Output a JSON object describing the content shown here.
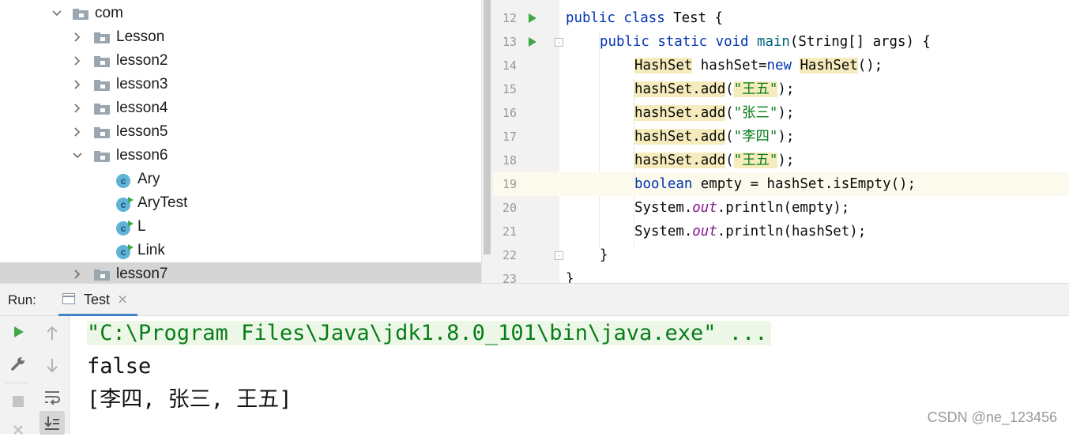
{
  "project_tree": {
    "items": [
      {
        "label": "com",
        "type": "package",
        "expanded": true
      },
      {
        "label": "Lesson",
        "type": "package",
        "expanded": false
      },
      {
        "label": "lesson2",
        "type": "package",
        "expanded": false
      },
      {
        "label": "lesson3",
        "type": "package",
        "expanded": false
      },
      {
        "label": "lesson4",
        "type": "package",
        "expanded": false
      },
      {
        "label": "lesson5",
        "type": "package",
        "expanded": false
      },
      {
        "label": "lesson6",
        "type": "package",
        "expanded": true
      },
      {
        "label": "Ary",
        "type": "class"
      },
      {
        "label": "AryTest",
        "type": "runnable-class"
      },
      {
        "label": "L",
        "type": "runnable-class"
      },
      {
        "label": "Link",
        "type": "runnable-class"
      },
      {
        "label": "lesson7",
        "type": "package",
        "expanded": false,
        "selected": true
      }
    ],
    "class_icon_letter": "c"
  },
  "editor": {
    "line_numbers": [
      "12",
      "13",
      "14",
      "15",
      "16",
      "17",
      "18",
      "19",
      "20",
      "21",
      "22",
      "23"
    ],
    "lines": {
      "l12": {
        "kw1": "public",
        "kw2": "class",
        "rest": " Test {"
      },
      "l13": {
        "kw1": "public",
        "kw2": "static",
        "kw3": "void",
        "fn": "main",
        "rest": "(String[] args) {"
      },
      "l14": {
        "type1": "HashSet",
        "mid": " hashSet=",
        "kw": "new",
        "type2": "HashSet",
        "rest": "();"
      },
      "l15": {
        "call": "hashSet.add",
        "open": "(",
        "str": "\"王五\"",
        "close": ");"
      },
      "l16": {
        "call": "hashSet.add",
        "open": "(",
        "str": "\"张三\"",
        "close": ");"
      },
      "l17": {
        "call": "hashSet.add",
        "open": "(",
        "str": "\"李四\"",
        "close": ");"
      },
      "l18": {
        "call": "hashSet.add",
        "open": "(",
        "str": "\"王五\"",
        "close": ");"
      },
      "l19": {
        "kw": "boolean",
        "rest": " empty = hashSet.isEmpty();"
      },
      "l20": {
        "pre": "System.",
        "fld": "out",
        "rest": ".println(empty);"
      },
      "l21": {
        "pre": "System.",
        "fld": "out",
        "rest": ".println(hashSet);"
      },
      "l22": {
        "rest": "}"
      },
      "l23": {
        "rest": "}"
      }
    },
    "fold_marker": "-"
  },
  "run_panel": {
    "label": "Run:",
    "tab_name": "Test",
    "tab_close": "×",
    "toolbar_icons": [
      "run-icon",
      "up-arrow-icon",
      "wrench-icon",
      "down-arrow-icon",
      "stop-icon",
      "soft-wrap-icon",
      "scroll-to-end-icon",
      "close-icon"
    ],
    "console": {
      "command": "\"C:\\Program Files\\Java\\jdk1.8.0_101\\bin\\java.exe\" ...",
      "output1": "false",
      "output2": "[李四, 张三, 王五]"
    }
  },
  "watermark": "CSDN @ne_123456",
  "colors": {
    "keyword": "#0033b3",
    "method": "#00627a",
    "string": "#067d17",
    "static_field": "#871094",
    "run_green": "#3fa84a",
    "selection_gray": "#d5d5d5"
  }
}
